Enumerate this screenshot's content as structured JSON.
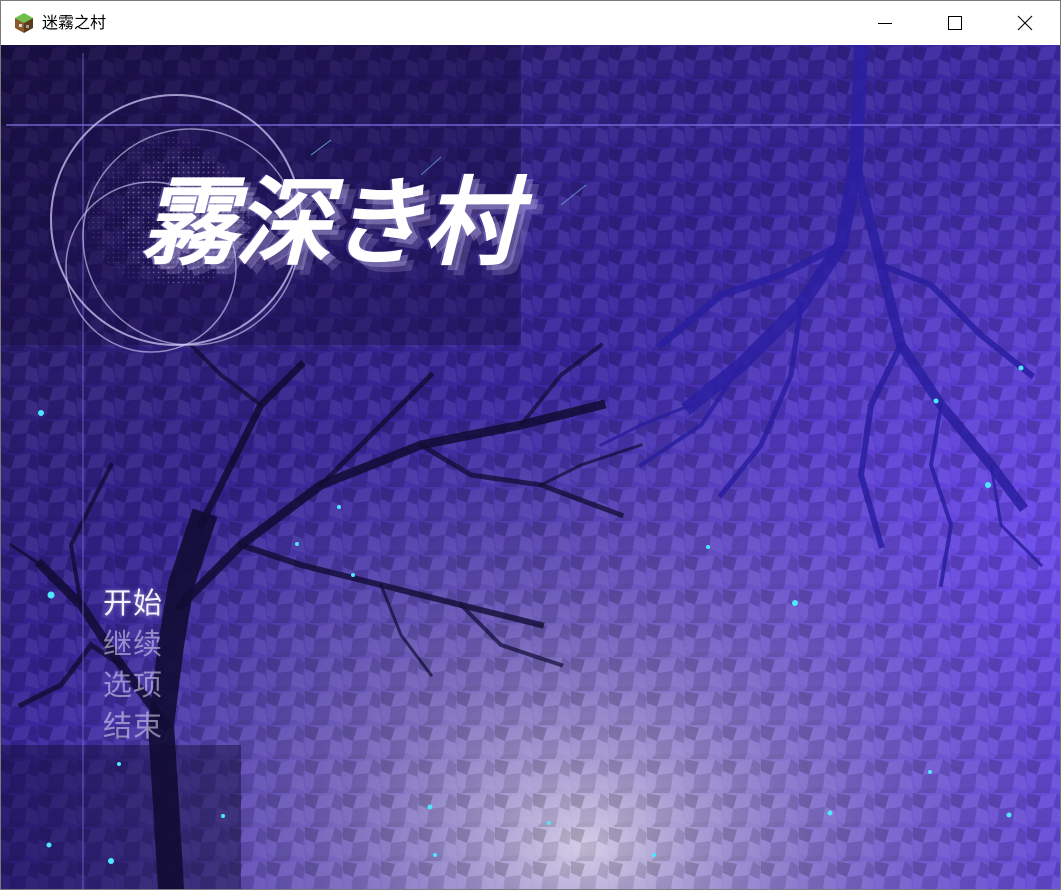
{
  "window": {
    "title": "迷霧之村",
    "icons": {
      "app": "game-app-icon",
      "minimize": "minimize-icon",
      "maximize": "maximize-icon",
      "close": "close-icon"
    }
  },
  "game": {
    "logo_title": "霧深き村",
    "menu": [
      {
        "label": "开始",
        "state": "selected"
      },
      {
        "label": "继续",
        "state": "disabled"
      },
      {
        "label": "选项",
        "state": "normal"
      },
      {
        "label": "结束",
        "state": "normal"
      }
    ],
    "colors": {
      "background": "#2c1d6b",
      "accent_violet": "#6f4ee8",
      "fog": "#c9c2dc",
      "particle": "#4fe6ff",
      "tree": "#14103a",
      "line": "#7d73e6"
    }
  }
}
